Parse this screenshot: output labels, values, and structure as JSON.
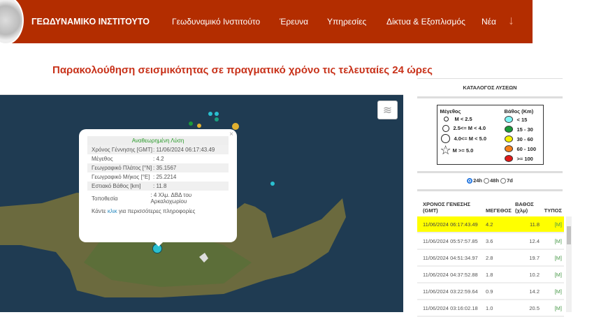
{
  "header": {
    "brand": "ΓΕΩΔΥΝΑΜΙΚΟ ΙΝΣΤΙΤΟΥΤΟ",
    "nav": [
      "Γεωδυναμικό Ινστιτούτο",
      "Έρευνα",
      "Υπηρεσίες",
      "Δίκτυα & Εξοπλισμός",
      "Νέα"
    ],
    "arrow": "↓"
  },
  "title": "Παρακολούθηση σεισμικότητας σε πραγματικό χρόνο τις τελευταίες 24 ώρες",
  "popup": {
    "close": "×",
    "heading": "Αναθεωρημένη Λύση",
    "rows": [
      {
        "k": "Χρόνος Γέννησης [GMT]",
        "v": ": 11/06/2024 06:17:43.49"
      },
      {
        "k": "Μέγεθος",
        "v": ": 4.2"
      },
      {
        "k": "Γεωγραφικό Πλάτος [°N]",
        "v": ": 35.1567"
      },
      {
        "k": "Γεωγραφικό Μήκος [°E]",
        "v": ": 25.2214"
      },
      {
        "k": "Εστιακό Βάθος [km]",
        "v": ": 11.8"
      },
      {
        "k": "Τοποθεσία",
        "v": ": 4 Χλμ. ΔΒΔ του Αρκαλοχωρίου"
      }
    ],
    "more_pre": "Κάντε ",
    "more_link": "κλικ",
    "more_post": " για περισσότερες πληροφορίες"
  },
  "catalog": {
    "title": "ΚΑΤΑΛΟΓΟΣ ΛΥΣΕΩΝ",
    "legend": {
      "mag_title": "Μέγεθος",
      "mags": [
        "M < 2.5",
        "2.5<= M < 4.0",
        "4.0<= M < 5.0",
        "M >= 5.0"
      ],
      "depth_title": "Βάθος (Km)",
      "depths": [
        {
          "l": "< 15",
          "c": "#7ff5f5"
        },
        {
          "l": "15 - 30",
          "c": "#1a9a3a"
        },
        {
          "l": "30 - 60",
          "c": "#f5f000"
        },
        {
          "l": "60 - 100",
          "c": "#f57f1a"
        },
        {
          "l": ">= 100",
          "c": "#e01a1a"
        }
      ]
    },
    "periods": [
      "24h",
      "48h",
      "7d"
    ],
    "selected_period": "24h",
    "columns": [
      "ΧΡΟΝΟΣ ΓΕΝΕΣΗΣ (GMT)",
      "ΜΕΓΕΘΟΣ",
      "ΒΑΘΟΣ (χλμ)",
      "ΤΥΠΟΣ"
    ],
    "rows": [
      [
        "11/06/2024 06:17:43.49",
        "4.2",
        "11.8",
        "[M]"
      ],
      [
        "11/06/2024 05:57:57.85",
        "3.6",
        "12.4",
        "[M]"
      ],
      [
        "11/06/2024 04:51:34.97",
        "2.8",
        "19.7",
        "[M]"
      ],
      [
        "11/06/2024 04:37:52.88",
        "1.8",
        "10.2",
        "[M]"
      ],
      [
        "11/06/2024 03:22:59.64",
        "0.9",
        "14.2",
        "[M]"
      ],
      [
        "11/06/2024 03:16:02.18",
        "1.0",
        "20.5",
        "[M]"
      ]
    ]
  }
}
